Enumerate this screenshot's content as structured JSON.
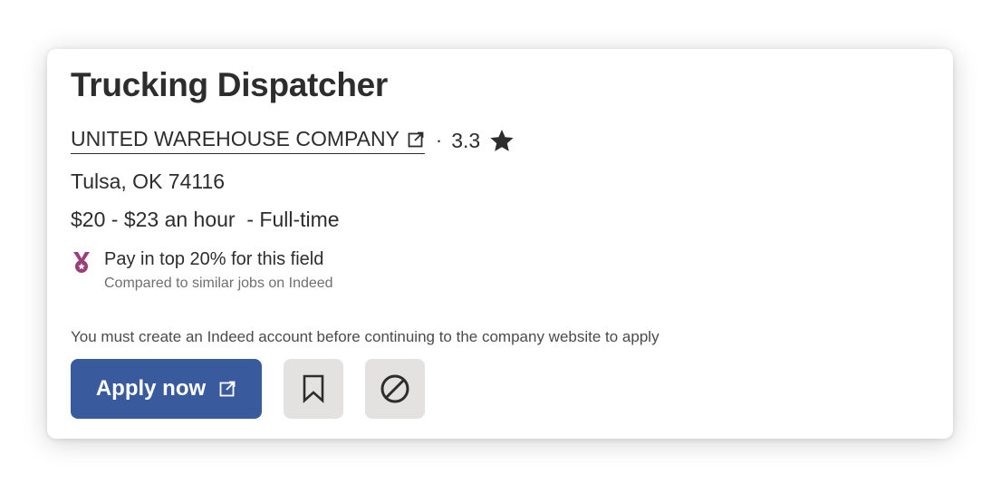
{
  "job": {
    "title": "Trucking Dispatcher",
    "company": "UNITED WAREHOUSE COMPANY",
    "separator": "·",
    "rating": "3.3",
    "location": "Tulsa, OK 74116",
    "salary": "$20 - $23 an hour",
    "job_type": "  - Full-time"
  },
  "pay_insight": {
    "headline": "Pay in top 20% for this field",
    "subtext": "Compared to similar jobs on Indeed",
    "icon": "medal-icon",
    "icon_color": "#9b3f7a"
  },
  "notice": "You must create an Indeed account before continuing to the company website to apply",
  "actions": {
    "apply_label": "Apply now",
    "apply_color": "#3a5a9e",
    "save_icon": "bookmark-icon",
    "not_interested_icon": "block-icon",
    "secondary_bg": "#e4e2e0"
  }
}
